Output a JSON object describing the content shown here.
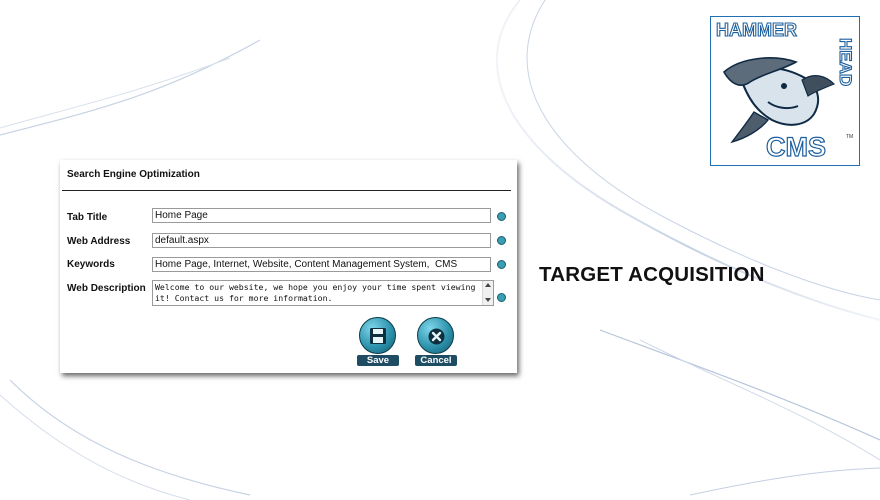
{
  "form": {
    "title": "Search Engine Optimization",
    "fields": [
      {
        "label": "Tab Title",
        "value": "Home Page"
      },
      {
        "label": "Web Address",
        "value": "default.aspx"
      },
      {
        "label": "Keywords",
        "value": "Home Page, Internet, Website, Content Management System,  CMS"
      },
      {
        "label": "Web Description",
        "value": "Welcome to our website, we hope you enjoy your time spent viewing it! Contact us for more information."
      }
    ],
    "save_label": "Save",
    "cancel_label": "Cancel"
  },
  "slide": {
    "heading": "TARGET ACQUISITION"
  },
  "logo": {
    "text_hammer": "HAMMER",
    "text_head": "HEAD",
    "text_cms": "CMS",
    "tm": "TM"
  },
  "colors": {
    "accent": "#3a9fb1",
    "button_label_bg": "#1e4d63",
    "logo_border": "#1f6fb2"
  },
  "icons": [
    "help-dot-icon",
    "floppy-disk-icon",
    "close-x-icon"
  ]
}
